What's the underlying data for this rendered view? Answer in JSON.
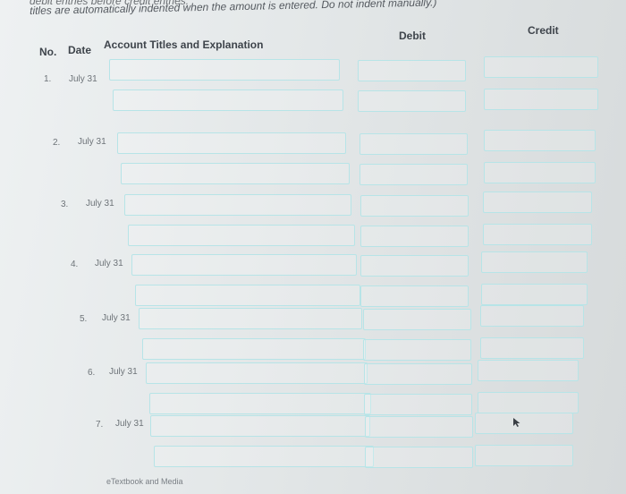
{
  "instructions": {
    "line1": "debit entries before credit entries.",
    "line2": "titles are automatically indented when the amount is entered. Do not indent manually.)"
  },
  "table_header": {
    "no": "No.",
    "date": "Date",
    "account": "Account Titles and Explanation",
    "debit": "Debit",
    "credit": "Credit"
  },
  "entries": [
    {
      "no": "1.",
      "date": "July 31"
    },
    {
      "no": "2.",
      "date": "July 31"
    },
    {
      "no": "3.",
      "date": "July 31"
    },
    {
      "no": "4.",
      "date": "July 31"
    },
    {
      "no": "5.",
      "date": "July 31"
    },
    {
      "no": "6.",
      "date": "July 31"
    },
    {
      "no": "7.",
      "date": "July 31"
    }
  ],
  "footer": {
    "link": "eTextbook and Media"
  }
}
